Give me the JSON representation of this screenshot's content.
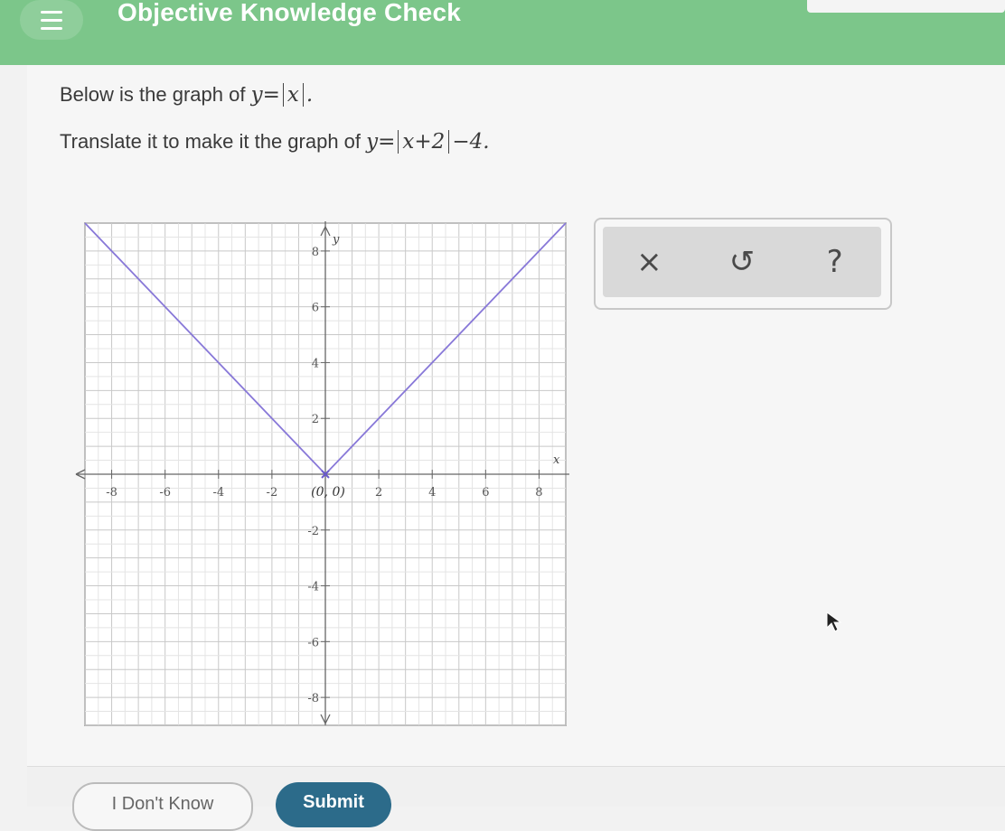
{
  "header": {
    "title": "Objective Knowledge Check",
    "menu_icon": "hamburger-menu-icon"
  },
  "question": {
    "line1_text": "Below is the graph of",
    "line1_math_lhs": "y=",
    "line1_math_abs": "x",
    "line1_end": ".",
    "line2_text": "Translate it to make it the graph of",
    "line2_math_lhs": "y=",
    "line2_math_abs": "x+2",
    "line2_math_rest": "−4."
  },
  "toolbox": {
    "clear_icon": "×",
    "undo_icon": "↺",
    "help_icon": "?"
  },
  "buttons": {
    "dont_know": "I Don't Know",
    "submit": "Submit"
  },
  "chart_data": {
    "type": "line",
    "xlim": [
      -9,
      9
    ],
    "ylim": [
      -9,
      9
    ],
    "grid": true,
    "xlabel": "x",
    "ylabel": "y",
    "x_ticks": [
      -8,
      -6,
      -4,
      -2,
      2,
      4,
      6,
      8
    ],
    "y_ticks": [
      -8,
      -6,
      -4,
      -2,
      2,
      4,
      6,
      8
    ],
    "x_tick_labels": [
      "-8",
      "-6",
      "-4",
      "-2",
      "2",
      "4",
      "6",
      "8"
    ],
    "y_tick_labels": [
      "-8",
      "-6",
      "-4",
      "-2",
      "2",
      "4",
      "6",
      "8"
    ],
    "series": [
      {
        "x": [
          -9,
          0,
          9
        ],
        "y": [
          9,
          0,
          9
        ],
        "color": "#8878d8"
      }
    ],
    "vertex_label": "(0, 0)",
    "vertex": [
      0,
      0
    ]
  }
}
